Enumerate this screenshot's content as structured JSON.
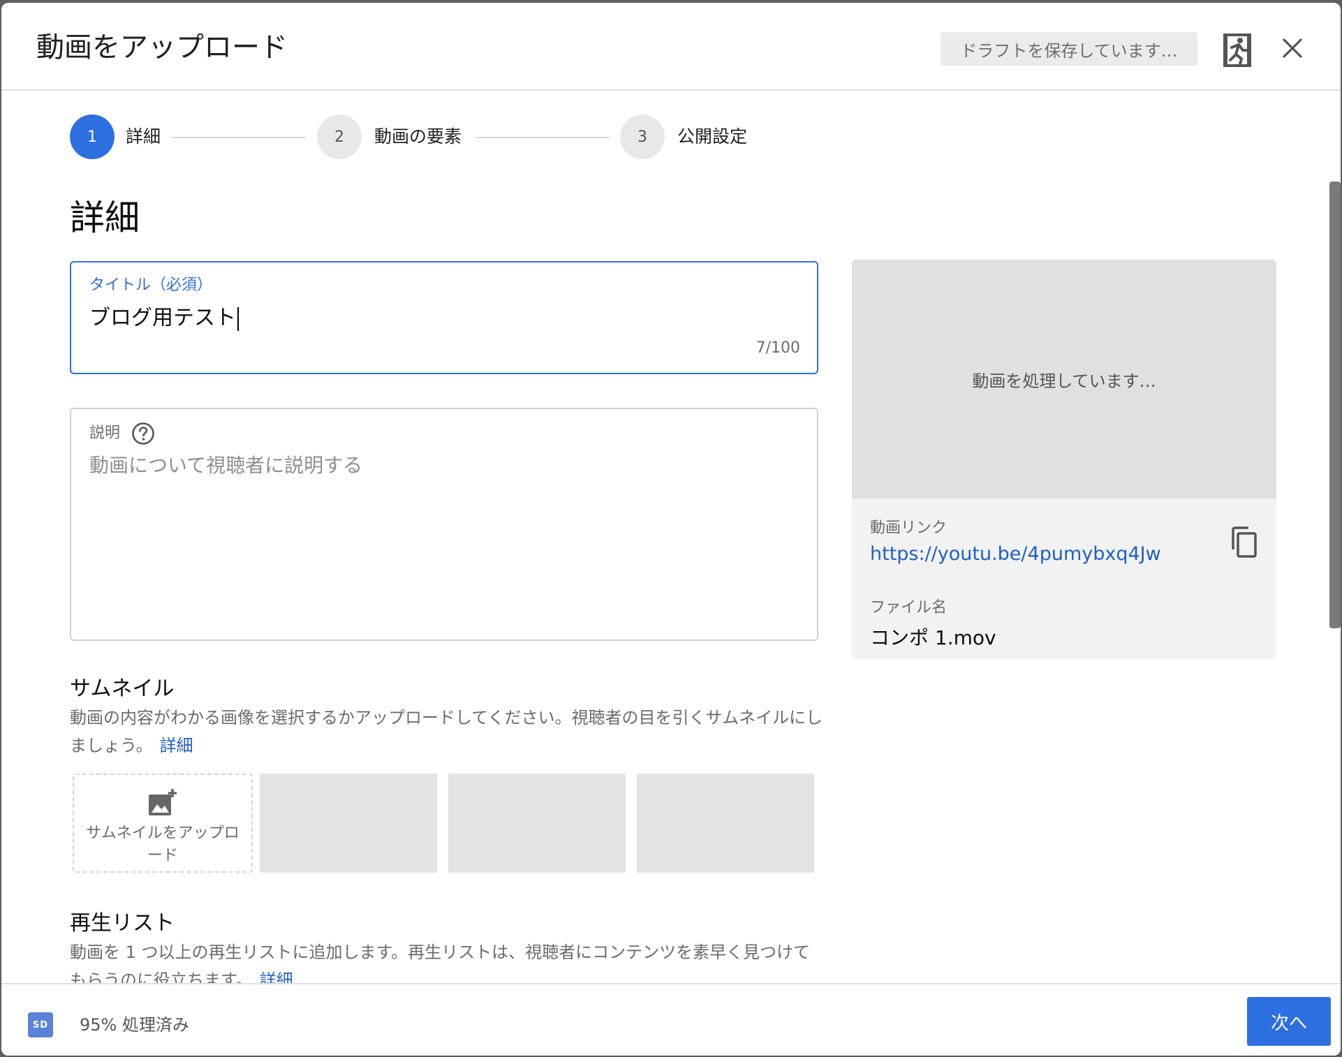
{
  "header": {
    "title": "動画をアップロード",
    "draft_status": "ドラフトを保存しています…",
    "exit_icon": "exit-person-icon",
    "close_icon": "close-icon"
  },
  "stepper": {
    "steps": [
      {
        "number": "1",
        "label": "詳細",
        "active": true
      },
      {
        "number": "2",
        "label": "動画の要素",
        "active": false
      },
      {
        "number": "3",
        "label": "公開設定",
        "active": false
      }
    ]
  },
  "details": {
    "section_title": "詳細",
    "title_field": {
      "label": "タイトル（必須）",
      "value": "ブログ用テスト",
      "counter": "7/100"
    },
    "description_field": {
      "label": "説明",
      "placeholder": "動画について視聴者に説明する",
      "help_icon": "help-circle-icon"
    }
  },
  "preview": {
    "processing_text": "動画を処理しています…",
    "link_label": "動画リンク",
    "link": "https://youtu.be/4pumybxq4Jw",
    "filename_label": "ファイル名",
    "filename": "コンポ 1.mov",
    "copy_icon": "copy-icon"
  },
  "thumbnail": {
    "title": "サムネイル",
    "description": "動画の内容がわかる画像を選択するかアップロードしてください。視聴者の目を引くサムネイルにしましょう。",
    "more_link": "詳細",
    "upload_label": "サムネイルをアップロード",
    "upload_icon": "add-photo-icon"
  },
  "playlist": {
    "title": "再生リスト",
    "description": "動画を 1 つ以上の再生リストに追加します。再生リストは、視聴者にコンテンツを素早く見つけてもらうのに役立ちます。",
    "more_link": "詳細"
  },
  "footer": {
    "badge": "SD",
    "processed": "95% 処理済み",
    "next_label": "次へ"
  },
  "colors": {
    "accent": "#2d6fe0",
    "link": "#1f5fc8"
  }
}
